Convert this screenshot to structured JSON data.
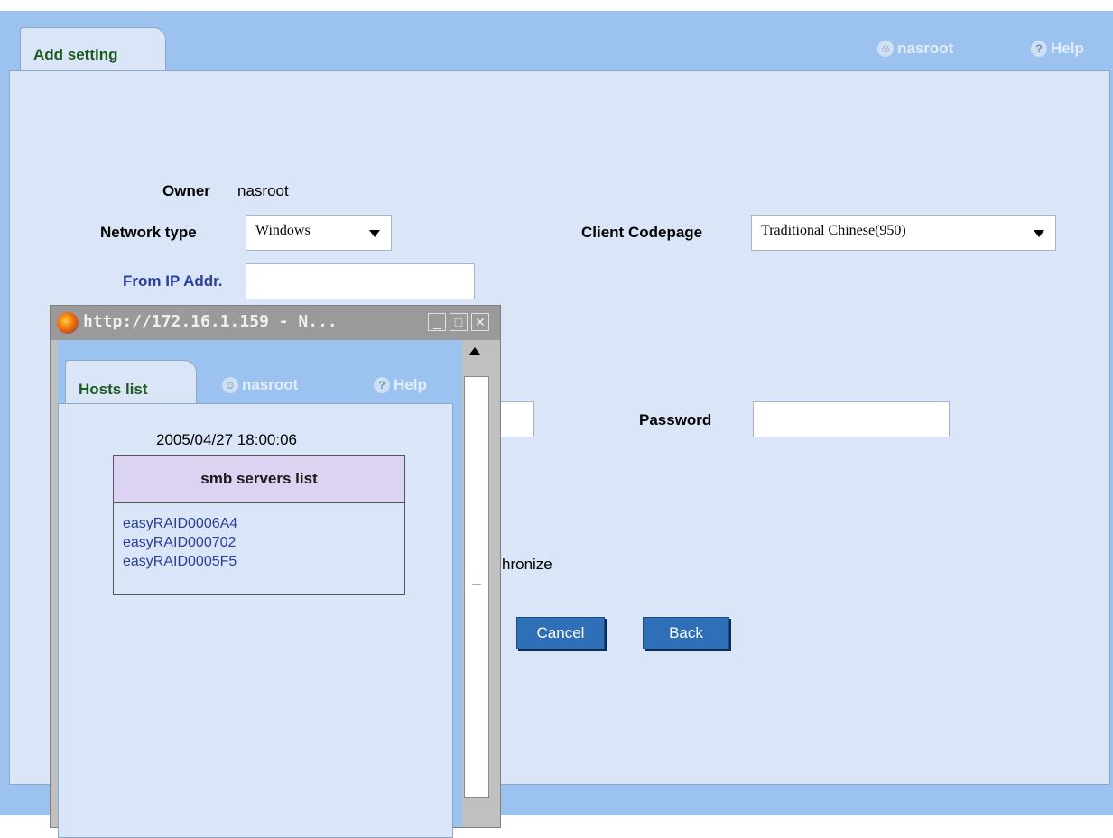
{
  "header": {
    "tab_label": "Add setting",
    "user_label": "nasroot",
    "help_label": "Help"
  },
  "form": {
    "owner_label": "Owner",
    "owner_value": "nasroot",
    "network_type_label": "Network type",
    "network_type_value": "Windows",
    "client_codepage_label": "Client Codepage",
    "client_codepage_value": "Traditional Chinese(950)",
    "from_ip_label": "From IP Addr.",
    "from_ip_value": "",
    "password_label": "Password",
    "password_value": "",
    "synchronize_partial": "hronize",
    "cancel_label": "Cancel",
    "back_label": "Back"
  },
  "popup": {
    "title": "http://172.16.1.159 - N...",
    "tab_label": "Hosts list",
    "user_label": "nasroot",
    "help_label": "Help",
    "timestamp": "2005/04/27 18:00:06",
    "list_header": "smb servers list",
    "servers": [
      "easyRAID0006A4",
      "easyRAID000702",
      "easyRAID0005F5"
    ]
  },
  "icons": {
    "user": "user-icon",
    "help": "help-icon",
    "browser": "firefox-icon"
  }
}
